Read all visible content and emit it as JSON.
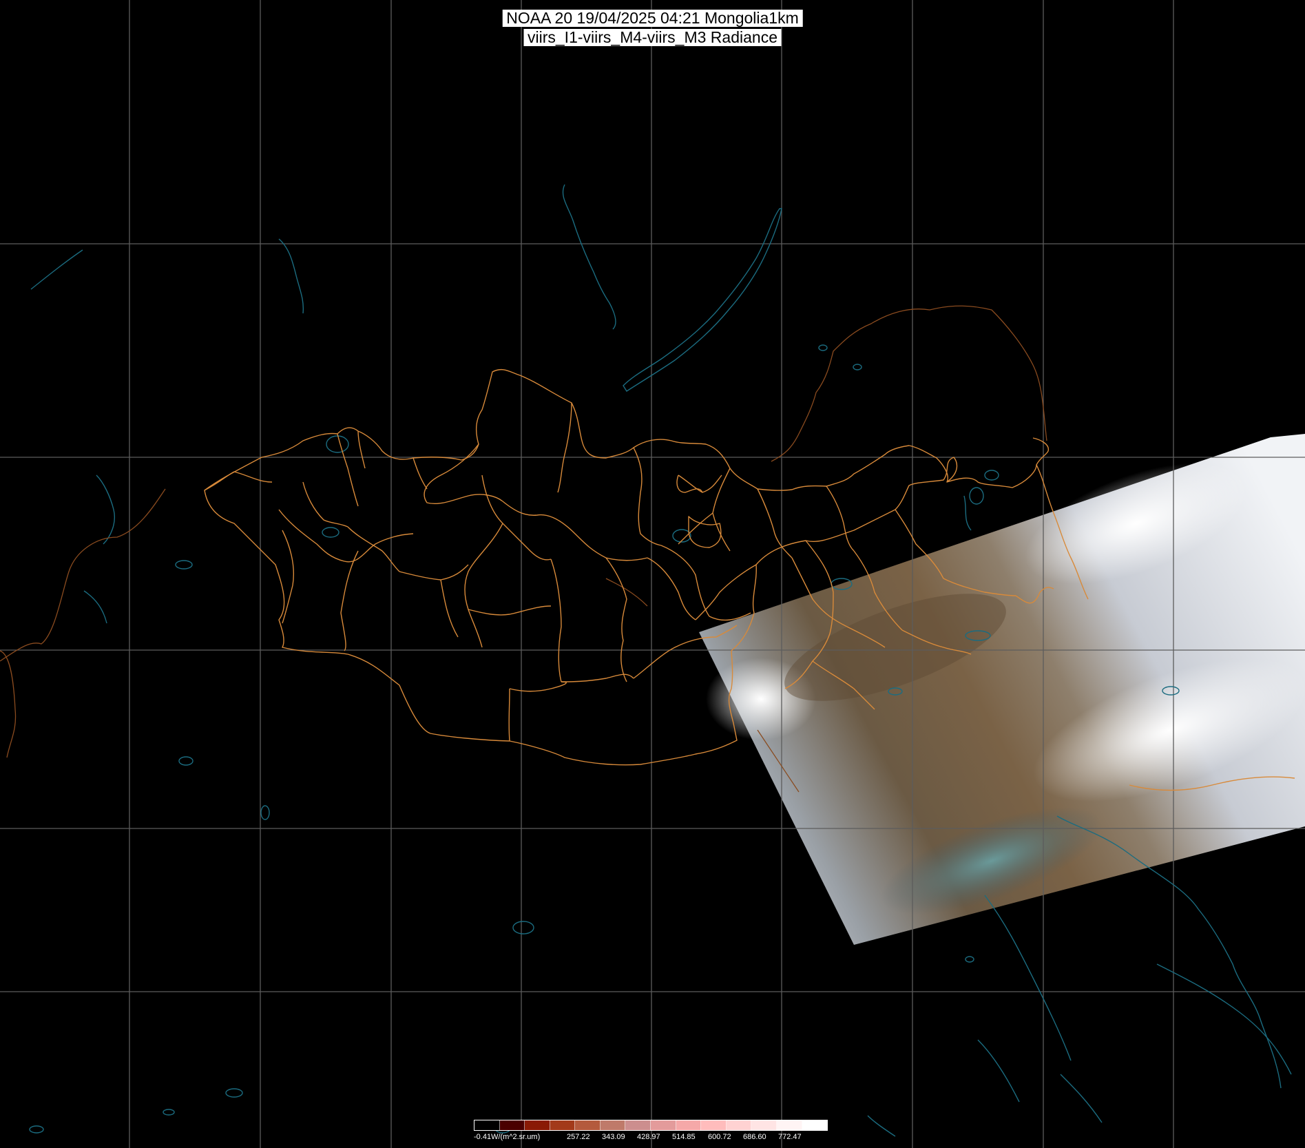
{
  "title": {
    "line1": "NOAA 20 19/04/2025 04:21 Mongolia1km",
    "line2": "viirs_I1-viirs_M4-viirs_M3 Radiance"
  },
  "colorbar": {
    "unit_label": "-0.41W/(m^2.sr.um)",
    "ticks": [
      "257.22",
      "343.09",
      "428.97",
      "514.85",
      "600.72",
      "686.60",
      "772.47"
    ],
    "colors": [
      "#000000",
      "#4a0000",
      "#8a1a05",
      "#a33a1a",
      "#b45a3d",
      "#bf7a6a",
      "#cc8e8e",
      "#e39b9b",
      "#f5a8a8",
      "#ffbcbc",
      "#ffd2d2",
      "#ffe4e4",
      "#fff4f4",
      "#ffffff"
    ]
  },
  "map_colors": {
    "graticule": "#5c5c5c",
    "coastline": "#1b6c80",
    "province_border": "#d88a3a",
    "country_border": "#8a4b1f"
  }
}
